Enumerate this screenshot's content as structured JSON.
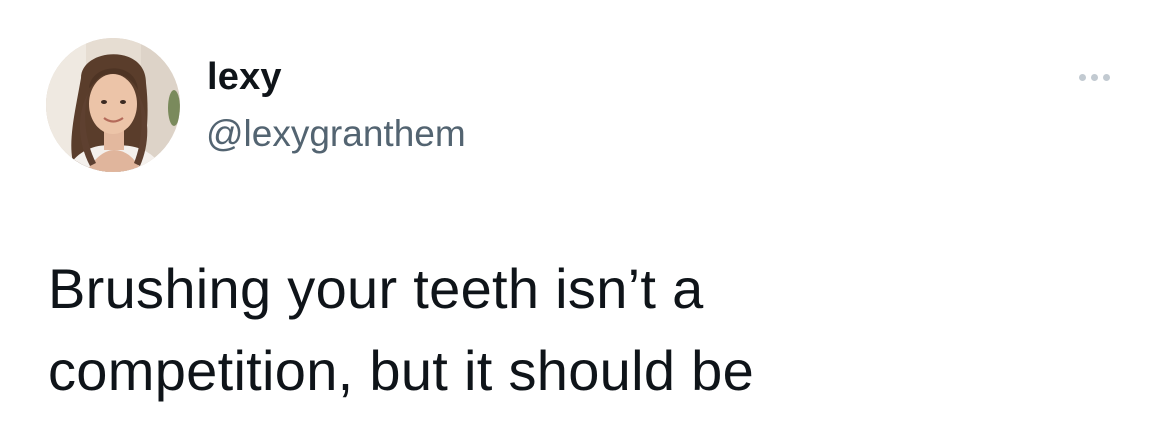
{
  "tweet": {
    "author": {
      "display_name": "lexy",
      "handle": "@lexygranthem"
    },
    "more_icon": "more-horizontal-icon",
    "text": "Brushing your teeth isn’t a\ncompetition, but it should be"
  },
  "colors": {
    "text_primary": "#0f1419",
    "text_secondary": "#536471",
    "icon_muted": "#c2cad1",
    "background": "#ffffff"
  }
}
